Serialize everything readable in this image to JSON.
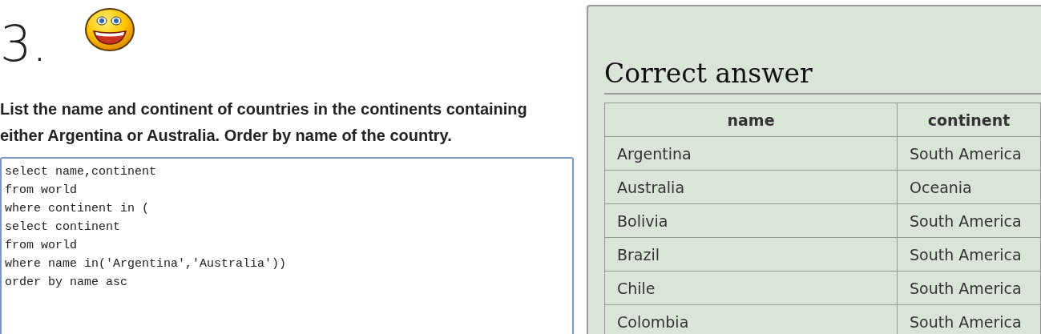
{
  "question": {
    "number": "3.",
    "text": "List the name and continent of countries in the continents containing either Argentina or Australia. Order by name of the country."
  },
  "editor": {
    "value": "select name,continent\nfrom world\nwhere continent in (\nselect continent\nfrom world\nwhere name in('Argentina','Australia'))\norder by name asc"
  },
  "answer": {
    "title": "Correct answer",
    "table": {
      "columns": [
        "name",
        "continent"
      ],
      "rows": [
        [
          "Argentina",
          "South America"
        ],
        [
          "Australia",
          "Oceania"
        ],
        [
          "Bolivia",
          "South America"
        ],
        [
          "Brazil",
          "South America"
        ],
        [
          "Chile",
          "South America"
        ],
        [
          "Colombia",
          "South America"
        ]
      ]
    }
  }
}
